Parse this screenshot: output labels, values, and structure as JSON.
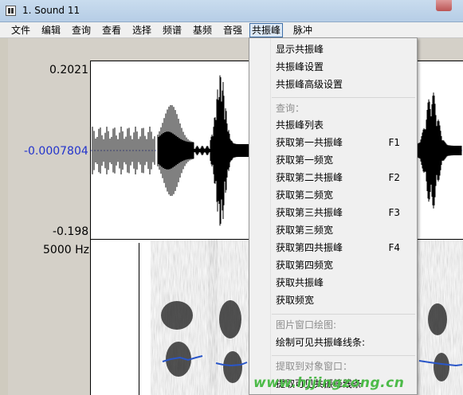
{
  "window": {
    "title": "1. Sound 11"
  },
  "menubar": {
    "items": [
      "文件",
      "编辑",
      "查询",
      "查看",
      "选择",
      "频谱",
      "基频",
      "音强",
      "共振峰",
      "脉冲"
    ],
    "active": "共振峰"
  },
  "editor": {
    "amp_max": "0.2021",
    "amp_mid": "-0.0007804",
    "amp_min": "-0.198",
    "freq_max": "5000 Hz"
  },
  "dropdown": {
    "items": [
      {
        "label": "显示共振峰",
        "key": "",
        "disabled": false
      },
      {
        "label": "共振峰设置",
        "key": "",
        "disabled": false
      },
      {
        "label": "共振峰高级设置",
        "key": "",
        "disabled": false
      },
      {
        "label": "查询：",
        "key": "",
        "disabled": true
      },
      {
        "label": "共振峰列表",
        "key": "",
        "disabled": false
      },
      {
        "label": "获取第一共振峰",
        "key": "F1",
        "disabled": false
      },
      {
        "label": "获取第一频宽",
        "key": "",
        "disabled": false
      },
      {
        "label": "获取第二共振峰",
        "key": "F2",
        "disabled": false
      },
      {
        "label": "获取第二频宽",
        "key": "",
        "disabled": false
      },
      {
        "label": "获取第三共振峰",
        "key": "F3",
        "disabled": false
      },
      {
        "label": "获取第三频宽",
        "key": "",
        "disabled": false
      },
      {
        "label": "获取第四共振峰",
        "key": "F4",
        "disabled": false
      },
      {
        "label": "获取第四频宽",
        "key": "",
        "disabled": false
      },
      {
        "label": "获取共振峰",
        "key": "",
        "disabled": false
      },
      {
        "label": "获取频宽",
        "key": "",
        "disabled": false
      },
      {
        "label": "图片窗口绘图:",
        "key": "",
        "disabled": true
      },
      {
        "label": "绘制可见共振峰线条:",
        "key": "",
        "disabled": false
      },
      {
        "label": "提取到对象窗口：",
        "key": "",
        "disabled": true
      },
      {
        "label": "提取可见共振峰线条",
        "key": "",
        "disabled": false
      }
    ]
  },
  "watermark": {
    "text": "www.hjjingzong.cn"
  },
  "colors": {
    "formant_track": "#2a56c8",
    "accent": "#3c6ea8"
  }
}
